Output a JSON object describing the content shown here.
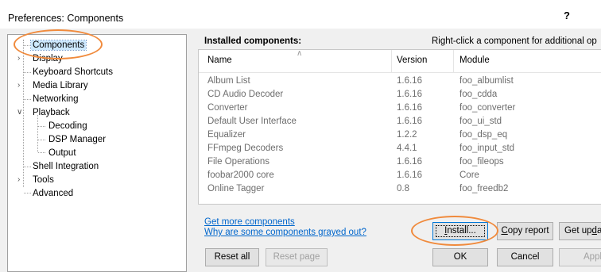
{
  "window": {
    "title": "Preferences: Components",
    "help_label": "?"
  },
  "tree": {
    "items": [
      {
        "label": "Components"
      },
      {
        "label": "Display"
      },
      {
        "label": "Keyboard Shortcuts"
      },
      {
        "label": "Media Library"
      },
      {
        "label": "Networking"
      },
      {
        "label": "Playback"
      },
      {
        "label": "Decoding"
      },
      {
        "label": "DSP Manager"
      },
      {
        "label": "Output"
      },
      {
        "label": "Shell Integration"
      },
      {
        "label": "Tools"
      },
      {
        "label": "Advanced"
      }
    ],
    "selected": "Components"
  },
  "panel": {
    "title": "Installed components:",
    "hint": "Right-click a component for additional op",
    "columns": [
      "Name",
      "Version",
      "Module"
    ],
    "rows": [
      [
        "Album List",
        "1.6.16",
        "foo_albumlist"
      ],
      [
        "CD Audio Decoder",
        "1.6.16",
        "foo_cdda"
      ],
      [
        "Converter",
        "1.6.16",
        "foo_converter"
      ],
      [
        "Default User Interface",
        "1.6.16",
        "foo_ui_std"
      ],
      [
        "Equalizer",
        "1.2.2",
        "foo_dsp_eq"
      ],
      [
        "FFmpeg Decoders",
        "4.4.1",
        "foo_input_std"
      ],
      [
        "File Operations",
        "1.6.16",
        "foo_fileops"
      ],
      [
        "foobar2000 core",
        "1.6.16",
        "Core"
      ],
      [
        "Online Tagger",
        "0.8",
        "foo_freedb2"
      ]
    ]
  },
  "links": {
    "get_more": "Get more components",
    "grayed_out": "Why are some components grayed out?"
  },
  "buttons": {
    "install": {
      "pre": "",
      "accel": "I",
      "post": "nstall..."
    },
    "copy_report": {
      "pre": "",
      "accel": "C",
      "post": "opy report"
    },
    "get_updates": {
      "pre": "Get up",
      "accel": "d",
      "post": "ates"
    },
    "reset_all": "Reset all",
    "reset_page": "Reset page",
    "ok": "OK",
    "cancel": "Cancel",
    "apply": "Apply"
  },
  "colors": {
    "annotation": "#f08a3c",
    "link": "#0066cc",
    "selection": "#cce8ff",
    "default_button_border": "#0078d7"
  }
}
